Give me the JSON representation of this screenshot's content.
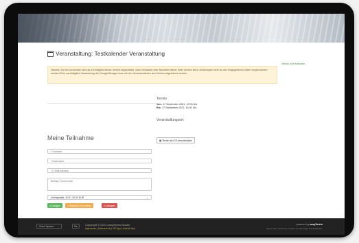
{
  "page": {
    "title": "Veranstaltung: Testkalender Veranstaltung",
    "back_link": "zurück zum Kalender",
    "notice": "Hinweis: Du bist momentan nicht als ein Mitglied dieses Vereins angemeldet. Nach Verlassen oder Neuladen dieser Seite können keine Änderungen mehr an den eingegebenen Daten vorgenommen werden! Eine nachträgliche Bearbeitung der Zusage/Absage muss mit den Verantwortlichen des Vereins abgestimmt werden."
  },
  "event": {
    "termin_heading": "Termin",
    "von_label": "Von:",
    "von_value": "17 September 2021, 12:00 Uhr",
    "bis_label": "Bis:",
    "bis_value": "17 September 2021, 14:00 Uhr",
    "ort_heading": "Veranstaltungsort:",
    "ics_button": "Termin als ICS herunterladen"
  },
  "form": {
    "heading": "Meine Teilnahme",
    "vorname_placeholder": "* Vorname",
    "nachname_placeholder": "* Nachname",
    "email_placeholder": "* E-Mail Adresse",
    "comment_placeholder": "Beitrag / Kommentar",
    "select_value": "Vorlragsbeitr. 30 € / 30,00 EUR",
    "zusagen": "Zusagen",
    "unsicher": "Vielleicht noch unklar",
    "absagen": "Absagen"
  },
  "footer": {
    "language": "Select Sprache",
    "go_button": "Go",
    "copyright": "Copyright © 2021 easyVerein Muster",
    "links": "Impressum | Datenschutz | iOS App | Android App",
    "powered_prefix": "powered by ",
    "powered_brand": "easyVerein",
    "cookie_note": "Diese Seite verwendet Cookies um den Login bereitzustellen."
  },
  "colors": {
    "green": "#5cb85c",
    "orange": "#f0ad4e",
    "red": "#d9534f",
    "notice_bg": "#fcf3d9"
  },
  "icons": [
    "calendar-icon",
    "check-icon",
    "question-icon",
    "times-icon",
    "chevron-down-icon"
  ]
}
